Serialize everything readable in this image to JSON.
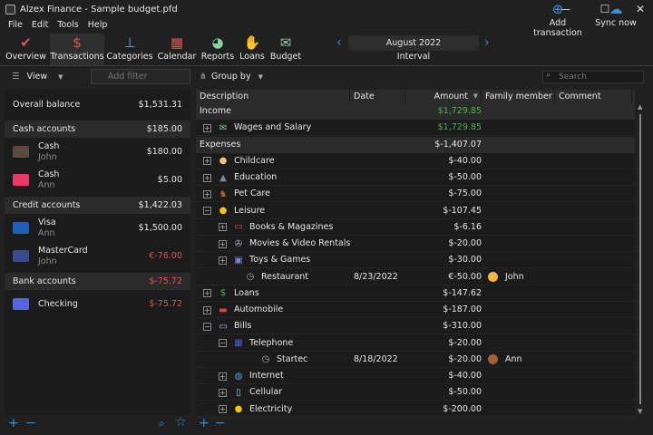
{
  "window": {
    "title": "Alzex Finance - Sample budget.pfd",
    "minimize": "—",
    "maximize": "☐",
    "close": "✕"
  },
  "menu": [
    "File",
    "Edit",
    "Tools",
    "Help"
  ],
  "toolbar": {
    "items": [
      {
        "label": "Overview",
        "icon": "calendar-check-icon"
      },
      {
        "label": "Transactions",
        "icon": "ledger-icon",
        "active": true
      },
      {
        "label": "Categories",
        "icon": "hierarchy-icon"
      },
      {
        "label": "Calendar",
        "icon": "calendar-icon"
      },
      {
        "label": "Reports",
        "icon": "pie-chart-icon"
      },
      {
        "label": "Loans",
        "icon": "money-hand-icon"
      },
      {
        "label": "Budget",
        "icon": "envelope-icon"
      }
    ],
    "interval_value": "August 2022",
    "interval_label": "Interval",
    "add_transaction": "Add transaction",
    "sync_now": "Sync now",
    "accent": "#3a8fd6"
  },
  "filterbar": {
    "view": "View",
    "add_filter_placeholder": "Add filter",
    "group_by": "Group by",
    "search_placeholder": "Search"
  },
  "accounts": {
    "overall": {
      "label": "Overall balance",
      "amount": "$1,531.31"
    },
    "groups": [
      {
        "label": "Cash accounts",
        "amount": "$185.00",
        "items": [
          {
            "name": "Cash",
            "owner": "John",
            "amount": "$180.00",
            "icon": "wallet-icon"
          },
          {
            "name": "Cash",
            "owner": "Ann",
            "amount": "$5.00",
            "icon": "purse-icon"
          }
        ]
      },
      {
        "label": "Credit accounts",
        "amount": "$1,422.03",
        "items": [
          {
            "name": "Visa",
            "owner": "Ann",
            "amount": "$1,500.00",
            "icon": "visa-icon"
          },
          {
            "name": "MasterCard",
            "owner": "John",
            "amount": "€-76.00",
            "icon": "mastercard-icon",
            "negative": true
          }
        ]
      },
      {
        "label": "Bank accounts",
        "amount": "$-75.72",
        "negative": true,
        "items": [
          {
            "name": "Checking",
            "owner": "",
            "amount": "$-75.72",
            "icon": "check-icon",
            "negative": true
          }
        ]
      }
    ]
  },
  "table": {
    "columns": [
      "Description",
      "Date",
      "Amount",
      "Family member",
      "Comment"
    ],
    "rows": [
      {
        "type": "group",
        "desc": "Income",
        "amount": "$1,729.85",
        "color": "#4caf50"
      },
      {
        "type": "cat",
        "level": 0,
        "exp": "+",
        "icon": "money-envelope-icon",
        "desc": "Wages and Salary",
        "amount": "$1,729.85",
        "color": "#4caf50"
      },
      {
        "type": "group",
        "desc": "Expenses",
        "amount": "$-1,407.07"
      },
      {
        "type": "cat",
        "level": 0,
        "exp": "+",
        "icon": "baby-icon",
        "desc": "Childcare",
        "amount": "$-40.00"
      },
      {
        "type": "cat",
        "level": 0,
        "exp": "+",
        "icon": "graduation-cap-icon",
        "desc": "Education",
        "amount": "$-50.00"
      },
      {
        "type": "cat",
        "level": 0,
        "exp": "+",
        "icon": "dog-icon",
        "desc": "Pet Care",
        "amount": "$-75.00"
      },
      {
        "type": "cat",
        "level": 0,
        "exp": "−",
        "icon": "smiley-icon",
        "desc": "Leisure",
        "amount": "$-107.45"
      },
      {
        "type": "cat",
        "level": 1,
        "exp": "+",
        "icon": "book-icon",
        "desc": "Books & Magazines",
        "amount": "$-6.16"
      },
      {
        "type": "cat",
        "level": 1,
        "exp": "+",
        "icon": "film-reel-icon",
        "desc": "Movies & Video Rentals",
        "amount": "$-20.00"
      },
      {
        "type": "cat",
        "level": 1,
        "exp": "+",
        "icon": "gamepad-icon",
        "desc": "Toys & Games",
        "amount": "$-30.00"
      },
      {
        "type": "tx",
        "level": 1,
        "icon": "clock-icon",
        "desc": "Restaurant",
        "date": "8/23/2022",
        "amount": "€-50.00",
        "member": "John"
      },
      {
        "type": "cat",
        "level": 0,
        "exp": "+",
        "icon": "dollar-cycle-icon",
        "desc": "Loans",
        "amount": "$-147.62"
      },
      {
        "type": "cat",
        "level": 0,
        "exp": "+",
        "icon": "car-icon",
        "desc": "Automobile",
        "amount": "$-187.00"
      },
      {
        "type": "cat",
        "level": 0,
        "exp": "−",
        "icon": "bill-icon",
        "desc": "Bills",
        "amount": "$-310.00"
      },
      {
        "type": "cat",
        "level": 1,
        "exp": "−",
        "icon": "telephone-icon",
        "desc": "Telephone",
        "amount": "$-20.00"
      },
      {
        "type": "tx",
        "level": 2,
        "icon": "clock-icon",
        "desc": "Startec",
        "date": "8/18/2022",
        "amount": "$-20.00",
        "member": "Ann"
      },
      {
        "type": "cat",
        "level": 1,
        "exp": "+",
        "icon": "globe-icon",
        "desc": "Internet",
        "amount": "$-40.00"
      },
      {
        "type": "cat",
        "level": 1,
        "exp": "+",
        "icon": "phone-icon",
        "desc": "Cellular",
        "amount": "$-50.00"
      },
      {
        "type": "cat",
        "level": 1,
        "exp": "+",
        "icon": "light-bulb-icon",
        "desc": "Electricity",
        "amount": "$-200.00"
      }
    ]
  },
  "colors": {
    "negative": "#d9534f",
    "positive": "#4caf50"
  }
}
